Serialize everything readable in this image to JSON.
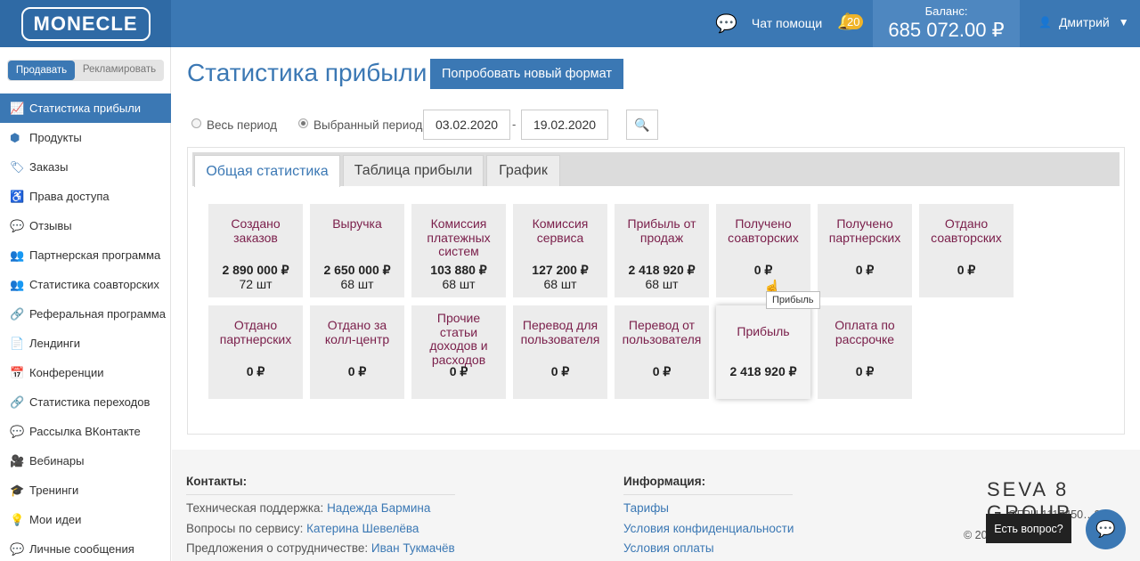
{
  "header": {
    "logo": "MONECLE",
    "chat_help": "Чат помощи",
    "notifications_count": "20",
    "balance_label": "Баланс:",
    "balance_value": "685 072.00 ₽",
    "user_name": "Дмитрий"
  },
  "sidebar": {
    "mode_sell": "Продавать",
    "mode_advertise": "Рекламировать",
    "items": [
      {
        "label": "Статистика прибыли",
        "icon": "chart-icon",
        "glyph": "📈"
      },
      {
        "label": "Продукты",
        "icon": "cubes-icon",
        "glyph": "⬢"
      },
      {
        "label": "Заказы",
        "icon": "tags-icon",
        "glyph": "🏷"
      },
      {
        "label": "Права доступа",
        "icon": "universal-access-icon",
        "glyph": "♿"
      },
      {
        "label": "Отзывы",
        "icon": "comments-icon",
        "glyph": "💬"
      },
      {
        "label": "Партнерская программа",
        "icon": "user-plus-icon",
        "glyph": "👥"
      },
      {
        "label": "Статистика соавторских",
        "icon": "user-plus-icon",
        "glyph": "👥"
      },
      {
        "label": "Реферальная программа",
        "icon": "link-icon",
        "glyph": "🔗"
      },
      {
        "label": "Лендинги",
        "icon": "file-icon",
        "glyph": "📄"
      },
      {
        "label": "Конференции",
        "icon": "calendar-icon",
        "glyph": "📅"
      },
      {
        "label": "Статистика переходов",
        "icon": "link-icon",
        "glyph": "🔗"
      },
      {
        "label": "Рассылка ВКонтакте",
        "icon": "comments-icon",
        "glyph": "💬"
      },
      {
        "label": "Вебинары",
        "icon": "video-camera-icon",
        "glyph": "🎥"
      },
      {
        "label": "Тренинги",
        "icon": "graduation-cap-icon",
        "glyph": "🎓"
      },
      {
        "label": "Мои идеи",
        "icon": "lightbulb-icon",
        "glyph": "💡"
      },
      {
        "label": "Личные сообщения",
        "icon": "comments-icon",
        "glyph": "💬"
      }
    ]
  },
  "main": {
    "title": "Статистика прибыли",
    "try_button": "Попробовать новый формат",
    "period_all": "Весь период",
    "period_selected": "Выбранный период",
    "date_from": "03.02.2020",
    "date_to": "19.02.2020",
    "date_separator": "-",
    "tabs": [
      "Общая статистика",
      "Таблица прибыли",
      "График"
    ],
    "cards": [
      {
        "title": "Создано заказов",
        "value": "2 890 000 ₽",
        "count": "72 шт"
      },
      {
        "title": "Выручка",
        "value": "2 650 000 ₽",
        "count": "68 шт"
      },
      {
        "title": "Комиссия платежных систем",
        "value": "103 880 ₽",
        "count": "68 шт"
      },
      {
        "title": "Комиссия сервиса",
        "value": "127 200 ₽",
        "count": "68 шт"
      },
      {
        "title": "Прибыль от продаж",
        "value": "2 418 920 ₽",
        "count": "68 шт"
      },
      {
        "title": "Получено соавторских",
        "value": "0 ₽",
        "count": ""
      },
      {
        "title": "Получено партнерских",
        "value": "0 ₽",
        "count": ""
      },
      {
        "title": "Отдано соавторских",
        "value": "0 ₽",
        "count": ""
      },
      {
        "title": "Отдано партнерских",
        "value": "0 ₽",
        "count": ""
      },
      {
        "title": "Отдано за колл-центр",
        "value": "0 ₽",
        "count": ""
      },
      {
        "title": "Прочие статьи доходов и расходов",
        "value": "0 ₽",
        "count": ""
      },
      {
        "title": "Перевод для пользователя",
        "value": "0 ₽",
        "count": ""
      },
      {
        "title": "Перевод от пользователя",
        "value": "0 ₽",
        "count": ""
      },
      {
        "title": "Прибыль",
        "value": "2 418 920 ₽",
        "count": ""
      },
      {
        "title": "Оплата по рассрочке",
        "value": "0 ₽",
        "count": ""
      }
    ],
    "tooltip": "Прибыль"
  },
  "footer": {
    "contacts_heading": "Контакты:",
    "contacts": [
      {
        "label": "Техническая поддержка:",
        "name": "Надежда Бармина"
      },
      {
        "label": "Вопросы по сервису:",
        "name": "Катерина Шевелёва"
      },
      {
        "label": "Предложения о сотрудничестве:",
        "name": "Иван Тукмачёв"
      }
    ],
    "info_heading": "Информация:",
    "info_links": [
      "Тарифы",
      "Условия конфиденциальности",
      "Условия оплаты"
    ],
    "brand": "SEVA 8 GROUP",
    "ogrn": "ОГРН 1117450…8",
    "copyright": "© 20… Gro…",
    "question": "Есть вопрос?"
  }
}
